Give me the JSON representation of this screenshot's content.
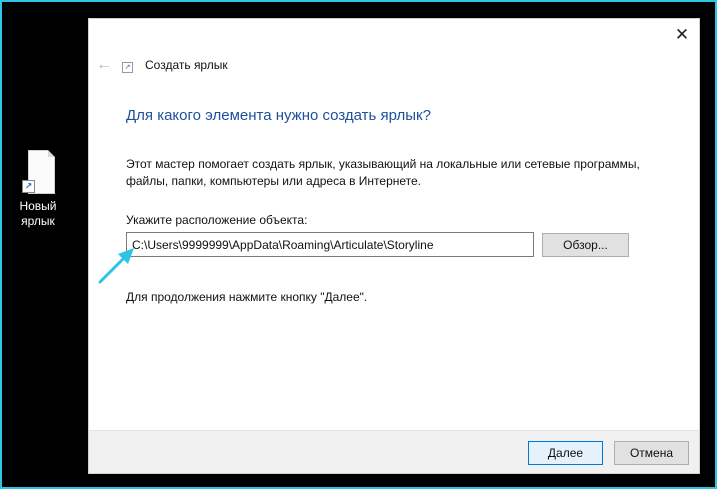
{
  "desktop": {
    "shortcut_label_line1": "Новый",
    "shortcut_label_line2": "ярлык"
  },
  "dialog": {
    "title": "Создать ярлык",
    "close_glyph": "✕",
    "back_glyph": "←",
    "heading": "Для какого элемента нужно создать ярлык?",
    "description_line1": "Этот мастер помогает создать ярлык, указывающий на локальные или сетевые программы,",
    "description_line2": "файлы, папки, компьютеры или адреса в Интернете.",
    "location_label": "Укажите расположение объекта:",
    "location_value": "C:\\Users\\9999999\\AppData\\Roaming\\Articulate\\Storyline",
    "browse_label": "Обзор...",
    "hint": "Для продолжения нажмите кнопку \"Далее\".",
    "next_label": "Далее",
    "cancel_label": "Отмена"
  },
  "colors": {
    "accent": "#2ec4e6",
    "heading": "#1d4f9c",
    "primary_button_border": "#0078d7"
  },
  "icons": [
    "shortcut-file-icon",
    "shortcut-arrow-icon",
    "back-arrow-icon",
    "close-icon",
    "callout-arrow-icon"
  ]
}
